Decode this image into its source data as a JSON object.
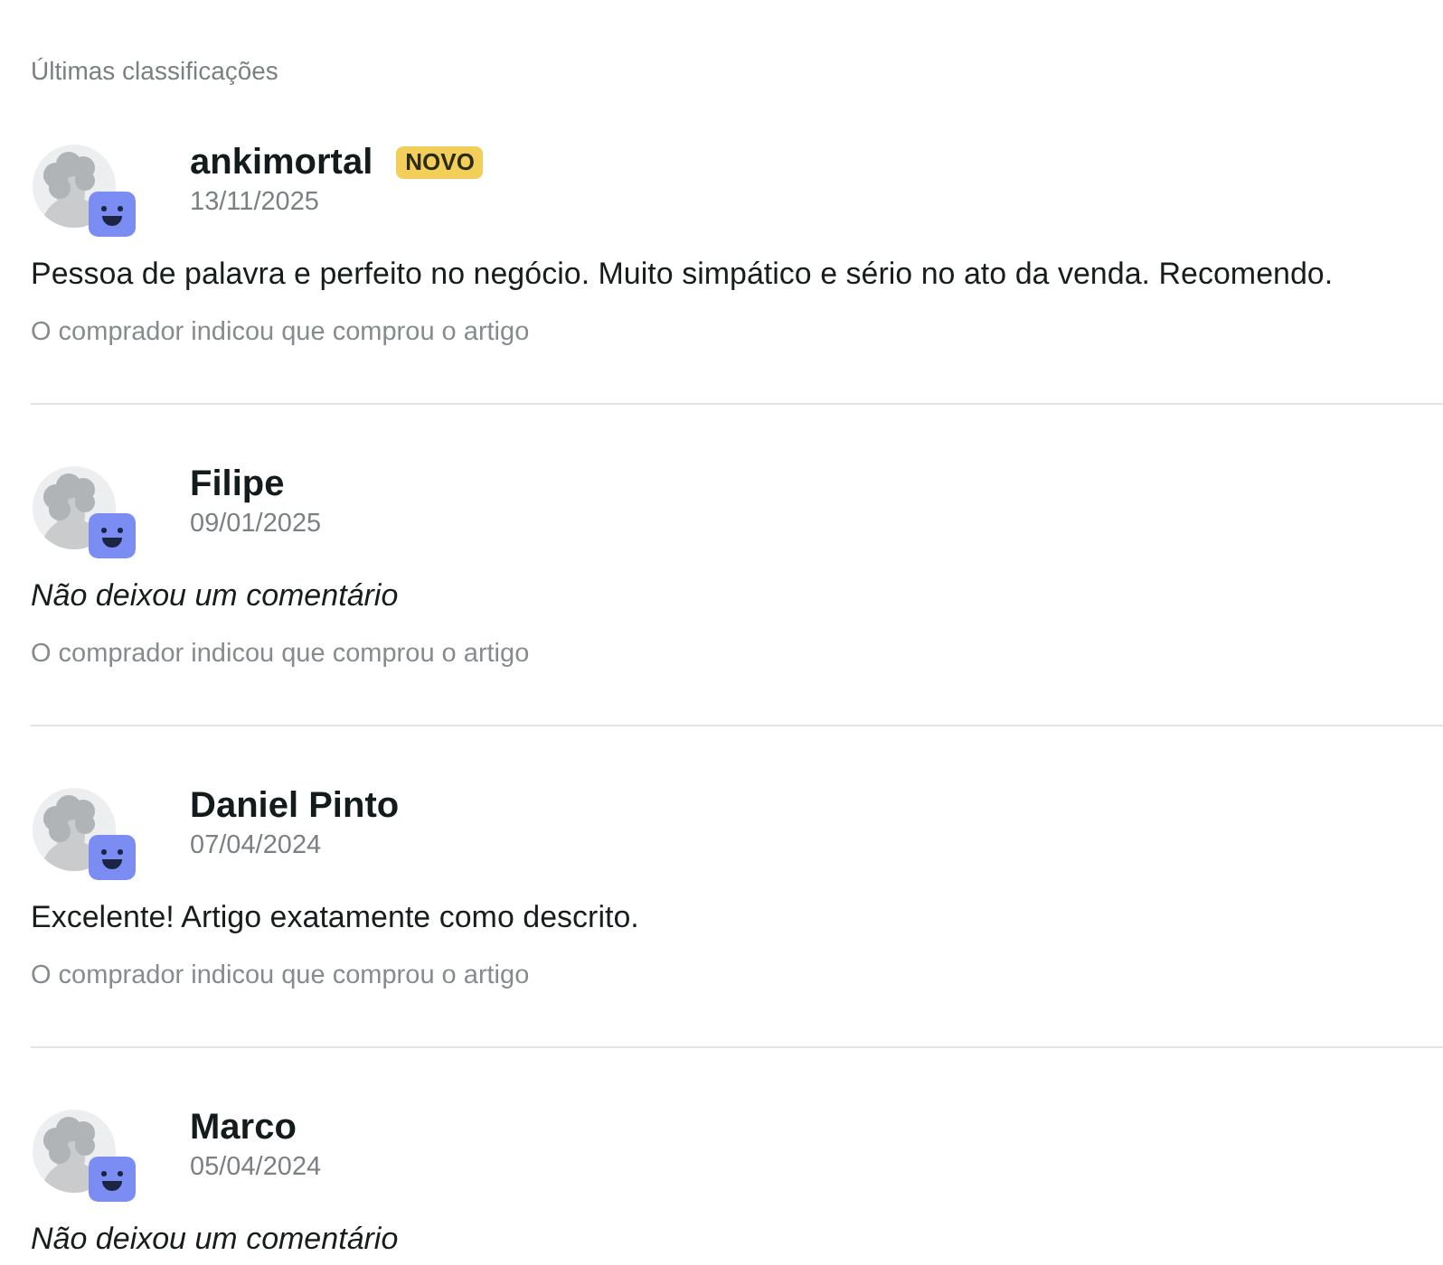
{
  "section": {
    "title": "Últimas classificações"
  },
  "reviews": [
    {
      "user": "ankimortal",
      "badge": "NOVO",
      "date": "13/11/2025",
      "comment": {
        "kind": "text",
        "text": "Pessoa de palavra e perfeito no negócio. Muito simpático e sério no ato da venda. Recomendo."
      },
      "note": "O comprador indicou que comprou o artigo"
    },
    {
      "user": "Filipe",
      "date": "09/01/2025",
      "comment": {
        "kind": "empty",
        "text": "Não deixou um comentário"
      },
      "note": "O comprador indicou que comprou o artigo"
    },
    {
      "user": "Daniel Pinto",
      "date": "07/04/2024",
      "comment": {
        "kind": "text",
        "text": "Excelente! Artigo exatamente como descrito."
      },
      "note": "O comprador indicou que comprou o artigo"
    },
    {
      "user": "Marco",
      "date": "05/04/2024",
      "comment": {
        "kind": "empty",
        "text": "Não deixou um comentário"
      }
    }
  ]
}
